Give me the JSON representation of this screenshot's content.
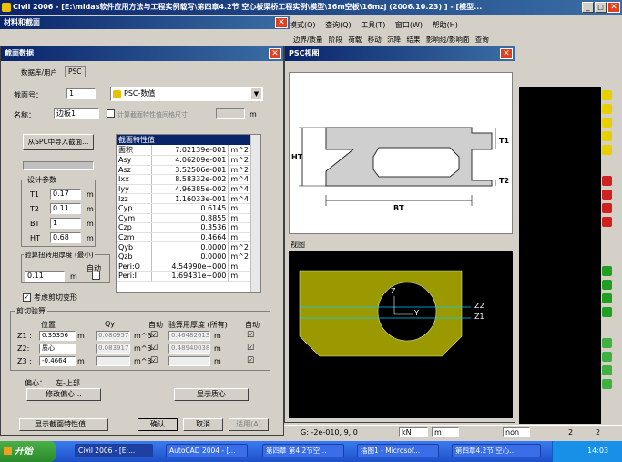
{
  "app": {
    "title": "Civil 2006 - [E:\\midas软件应用方法与工程实例载写\\第四章4.2节 空心板梁桥工程实例\\模型\\16m空板\\16mzj (2006.10.23) ] - [模型...",
    "menu": [
      "模式(Q)",
      "查询(Q)",
      "工具(T)",
      "窗口(W)",
      "帮助(H)"
    ],
    "toolbar_tabs": [
      "边界/质量",
      "阶段",
      "荷载",
      "移动",
      "沉降",
      "结果",
      "影响线/影响面",
      "查询"
    ]
  },
  "left_panel": {
    "title": "材料和截面"
  },
  "dialog": {
    "title": "截面数据",
    "tabs": [
      "数据库/用户",
      "PSC"
    ],
    "section_no_label": "截面号：",
    "section_no": "1",
    "type_value": "PSC-数值",
    "name_label": "名称：",
    "name_value": "边板1",
    "calc_label": "计算截面特性值间格尺寸:",
    "calc_unit": "m",
    "import_btn": "从SPC中导入截面...",
    "design_params_label": "设计参数",
    "params": [
      {
        "label": "T1",
        "value": "0.17",
        "unit": "m"
      },
      {
        "label": "T2",
        "value": "0.11",
        "unit": "m"
      },
      {
        "label": "BT",
        "value": "1",
        "unit": "m"
      },
      {
        "label": "HT",
        "value": "0.68",
        "unit": "m"
      }
    ],
    "shear_min_label": "验算扭转用厚度 (最小)",
    "auto_label": "自动",
    "min_thickness": "0.11",
    "min_unit": "m",
    "consider_shear_label": "考虑剪切变形",
    "props_header": "截面特性值",
    "props": [
      {
        "name": "面积",
        "value": "7.02139e-001",
        "unit": "m^2"
      },
      {
        "name": "Asy",
        "value": "4.06209e-001",
        "unit": "m^2"
      },
      {
        "name": "Asz",
        "value": "3.52506e-001",
        "unit": "m^2"
      },
      {
        "name": "Ixx",
        "value": "8.58332e-002",
        "unit": "m^4"
      },
      {
        "name": "Iyy",
        "value": "4.96385e-002",
        "unit": "m^4"
      },
      {
        "name": "Izz",
        "value": "1.16033e-001",
        "unit": "m^4"
      },
      {
        "name": "Cyp",
        "value": "0.6145",
        "unit": "m"
      },
      {
        "name": "Cym",
        "value": "0.8855",
        "unit": "m"
      },
      {
        "name": "Czp",
        "value": "0.3536",
        "unit": "m"
      },
      {
        "name": "Czm",
        "value": "0.4664",
        "unit": "m"
      },
      {
        "name": "Qyb",
        "value": "0.0000",
        "unit": "m^2"
      },
      {
        "name": "Qzb",
        "value": "0.0000",
        "unit": "m^2"
      },
      {
        "name": "Peri:O",
        "value": "4.54990e+000",
        "unit": "m"
      },
      {
        "name": "Peri:I",
        "value": "1.69431e+000",
        "unit": "m"
      }
    ],
    "shear_check_label": "剪切验算",
    "pos_header": "位置",
    "qy_header": "Qy",
    "auto_header": "自动",
    "thick_header": "验算用厚度 (所有)",
    "auto_header2": "自动",
    "shear_rows": [
      {
        "label": "Z1 :",
        "pos": "0.35356",
        "pos_unit": "m",
        "qy": "0.0809578",
        "qy_unit": "m^3",
        "auto": "☑",
        "thick": "0.464826133",
        "thick_unit": "m",
        "auto2": "☑"
      },
      {
        "label": "Z2:",
        "pos": "质心",
        "pos_unit": "",
        "qy": "0.0839171",
        "qy_unit": "m^3",
        "auto": "☑",
        "thick": "0.489400382",
        "thick_unit": "m",
        "auto2": "☑"
      },
      {
        "label": "Z3 :",
        "pos": "-0.4664",
        "pos_unit": "m",
        "qy": "",
        "qy_unit": "m^3",
        "auto": "☑",
        "thick": "",
        "thick_unit": "m",
        "auto2": "☑"
      }
    ],
    "offset_label": "偏心：",
    "offset_value": "左-上部",
    "modify_offset_btn": "修改偏心...",
    "show_centroid_btn": "显示质心",
    "show_props_btn": "显示截面特性值...",
    "ok_btn": "确认",
    "cancel_btn": "取消",
    "apply_btn": "适用(A)"
  },
  "psc_view": {
    "title": "PSC视图",
    "dim_labels": {
      "t1": "T1",
      "t2": "T2",
      "ht": "HT",
      "bt": "BT"
    },
    "view_label": "视图",
    "axis_labels": {
      "z": "Z",
      "y": "Y",
      "z2": "Z2",
      "z1": "Z1"
    }
  },
  "status": {
    "coords": "G: -2e-010, 9, 0",
    "unit1": "kN",
    "unit2": "m",
    "none_val": "non",
    "page": "2",
    "page_total": "2"
  },
  "taskbar": {
    "start": "开始",
    "items": [
      "Civil 2006 - [E:...",
      "AutoCAD 2004 - [...",
      "第四章 第4.2节空...",
      "插图1 - Microsof...",
      "第四章4.2节 空心..."
    ],
    "clock": "14:03"
  },
  "colors": {
    "title_blue": "#0a246a",
    "section_fill": "#9a9a00",
    "viewport_bg": "#000000",
    "line_cyan": "#00c8ff"
  }
}
